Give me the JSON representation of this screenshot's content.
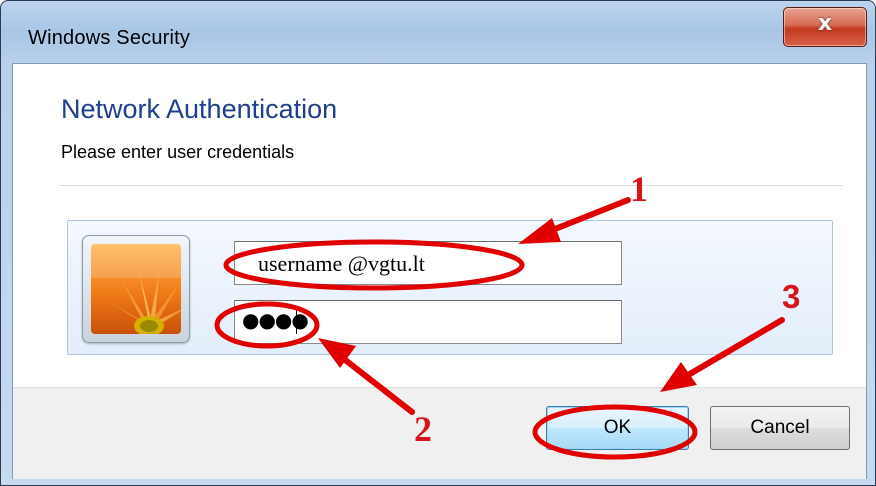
{
  "window": {
    "title": "Windows Security",
    "close_glyph": "x"
  },
  "dialog": {
    "heading": "Network Authentication",
    "subheading": "Please enter user credentials"
  },
  "credentials": {
    "username_value": "username @vgtu.lt",
    "password_mask": "●●●●"
  },
  "buttons": {
    "ok_label": "OK",
    "cancel_label": "Cancel"
  },
  "annotations": {
    "step1": "1",
    "step2": "2",
    "step3": "3",
    "color": "#e00000"
  },
  "colors": {
    "heading": "#1e3f8f",
    "close_button": "#c23a1f",
    "annotation_red": "#e00000"
  },
  "icons": {
    "avatar": "orange-flower-user-tile",
    "close": "close-icon"
  }
}
